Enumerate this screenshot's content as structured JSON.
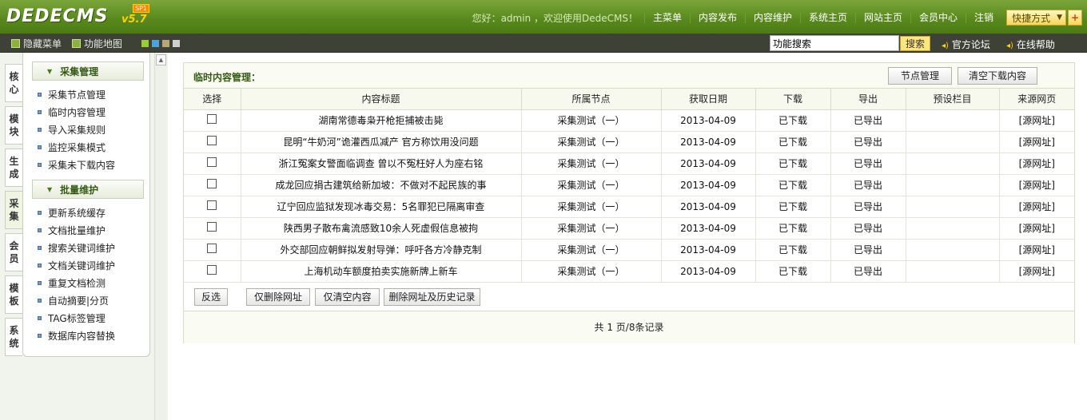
{
  "header": {
    "brand": "DEDECMS",
    "version": "v5.7",
    "edition": "SP1",
    "greeting": "您好：admin ，欢迎使用DedeCMS！",
    "nav": [
      "主菜单",
      "内容发布",
      "内容维护",
      "系统主页",
      "网站主页",
      "会员中心",
      "注销"
    ],
    "quick_label": "快捷方式",
    "plus_label": "+"
  },
  "subbar": {
    "hide_menu": "隐藏菜单",
    "site_map": "功能地图",
    "search_value": "功能搜索",
    "search_button": "搜索",
    "forum_link": "官方论坛",
    "help_link": "在线帮助",
    "swatch_colors": [
      "#9acd32",
      "#4aa3df",
      "#b8a878",
      "#d0d0d0"
    ]
  },
  "sidebar": {
    "tabs": [
      "核心",
      "模块",
      "生成",
      "采集",
      "会员",
      "模板",
      "系统"
    ],
    "active_tab": "采集",
    "groups": [
      {
        "title": "采集管理",
        "items": [
          "采集节点管理",
          "临时内容管理",
          "导入采集规则",
          "监控采集模式",
          "采集未下载内容"
        ]
      },
      {
        "title": "批量维护",
        "items": [
          "更新系统缓存",
          "文档批量维护",
          "搜索关键词维护",
          "文档关键词维护",
          "重复文档检测",
          "自动摘要|分页",
          "TAG标签管理",
          "数据库内容替换"
        ]
      }
    ]
  },
  "main": {
    "title": "临时内容管理：",
    "node_manage_button": "节点管理",
    "clear_button": "清空下载内容",
    "columns": [
      "选择",
      "内容标题",
      "所属节点",
      "获取日期",
      "下载",
      "导出",
      "预设栏目",
      "来源网页"
    ],
    "rows": [
      {
        "title": "湖南常德毒枭开枪拒捕被击毙",
        "node": "采集测试（一）",
        "date": "2013-04-09",
        "download": "已下载",
        "export": "已导出",
        "category": "",
        "source": "[源网址]"
      },
      {
        "title": "昆明“牛奶河”诡灌西瓜减产 官方称饮用没问题",
        "node": "采集测试（一）",
        "date": "2013-04-09",
        "download": "已下载",
        "export": "已导出",
        "category": "",
        "source": "[源网址]"
      },
      {
        "title": "浙江冤案女警面临调查 曾以不冤枉好人为座右铭",
        "node": "采集测试（一）",
        "date": "2013-04-09",
        "download": "已下载",
        "export": "已导出",
        "category": "",
        "source": "[源网址]"
      },
      {
        "title": "成龙回应捐古建筑给新加坡：不做对不起民族的事",
        "node": "采集测试（一）",
        "date": "2013-04-09",
        "download": "已下载",
        "export": "已导出",
        "category": "",
        "source": "[源网址]"
      },
      {
        "title": "辽宁回应监狱发现冰毒交易：5名罪犯已隔离审查",
        "node": "采集测试（一）",
        "date": "2013-04-09",
        "download": "已下载",
        "export": "已导出",
        "category": "",
        "source": "[源网址]"
      },
      {
        "title": "陕西男子散布禽流感致10余人死虚假信息被拘",
        "node": "采集测试（一）",
        "date": "2013-04-09",
        "download": "已下载",
        "export": "已导出",
        "category": "",
        "source": "[源网址]"
      },
      {
        "title": "外交部回应朝鲜拟发射导弹：呼吁各方冷静克制",
        "node": "采集测试（一）",
        "date": "2013-04-09",
        "download": "已下载",
        "export": "已导出",
        "category": "",
        "source": "[源网址]"
      },
      {
        "title": "上海机动车额度拍卖实施新牌上新车",
        "node": "采集测试（一）",
        "date": "2013-04-09",
        "download": "已下载",
        "export": "已导出",
        "category": "",
        "source": "[源网址]"
      }
    ],
    "actions": [
      "反选",
      "仅删除网址",
      "仅清空内容",
      "删除网址及历史记录"
    ],
    "pager": "共 1 页/8条记录"
  }
}
